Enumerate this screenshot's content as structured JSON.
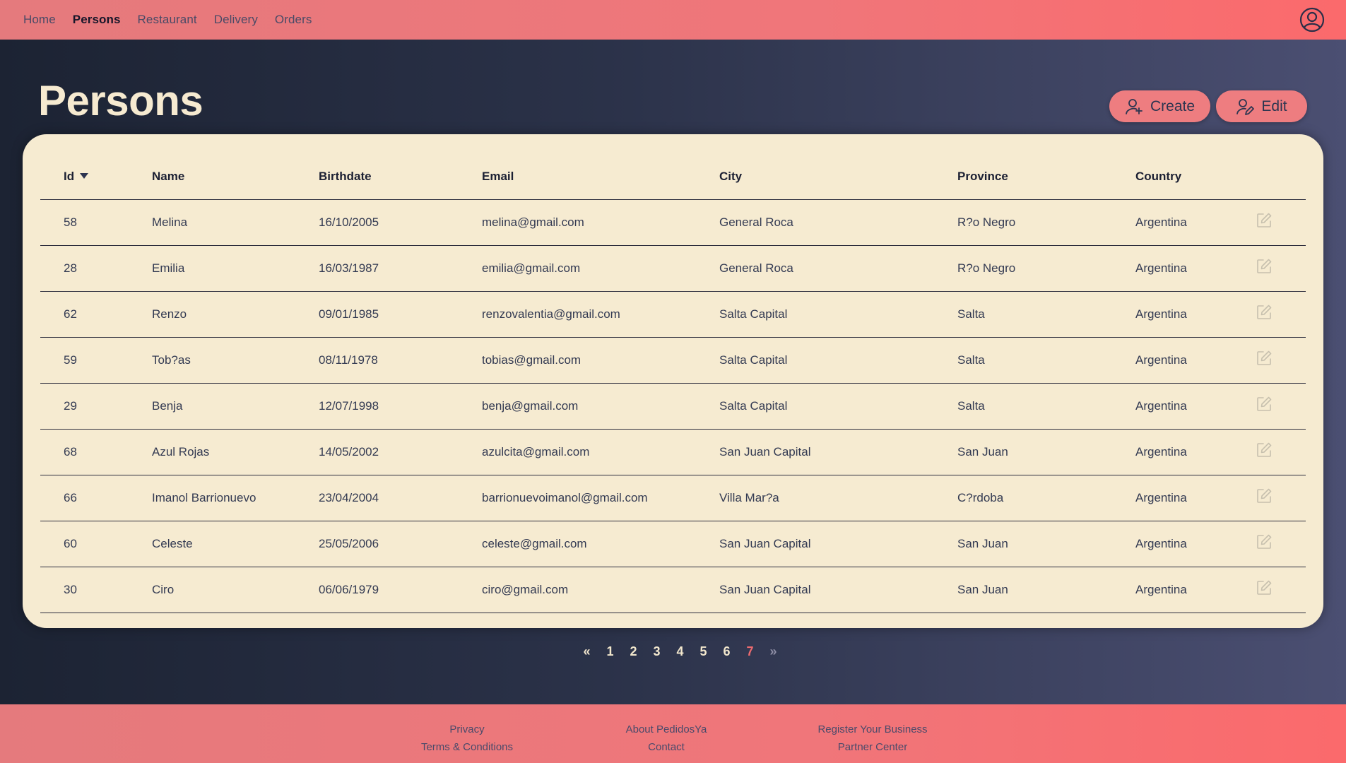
{
  "nav": {
    "items": [
      {
        "label": "Home",
        "active": false
      },
      {
        "label": "Persons",
        "active": true
      },
      {
        "label": "Restaurant",
        "active": false
      },
      {
        "label": "Delivery",
        "active": false
      },
      {
        "label": "Orders",
        "active": false
      }
    ],
    "user_icon": "user-circle-icon"
  },
  "page": {
    "title": "Persons",
    "create_label": "Create",
    "edit_label": "Edit"
  },
  "table": {
    "headers": {
      "id": "Id",
      "name": "Name",
      "birthdate": "Birthdate",
      "email": "Email",
      "city": "City",
      "province": "Province",
      "country": "Country"
    },
    "sort": {
      "column": "id",
      "direction": "desc"
    },
    "rows": [
      {
        "id": "58",
        "name": "Melina",
        "birthdate": "16/10/2005",
        "email": "melina@gmail.com",
        "city": "General Roca",
        "province": "R?o Negro",
        "country": "Argentina"
      },
      {
        "id": "28",
        "name": "Emilia",
        "birthdate": "16/03/1987",
        "email": "emilia@gmail.com",
        "city": "General Roca",
        "province": "R?o Negro",
        "country": "Argentina"
      },
      {
        "id": "62",
        "name": "Renzo",
        "birthdate": "09/01/1985",
        "email": "renzovalentia@gmail.com",
        "city": "Salta Capital",
        "province": "Salta",
        "country": "Argentina"
      },
      {
        "id": "59",
        "name": "Tob?as",
        "birthdate": "08/11/1978",
        "email": "tobias@gmail.com",
        "city": "Salta Capital",
        "province": "Salta",
        "country": "Argentina"
      },
      {
        "id": "29",
        "name": "Benja",
        "birthdate": "12/07/1998",
        "email": "benja@gmail.com",
        "city": "Salta Capital",
        "province": "Salta",
        "country": "Argentina"
      },
      {
        "id": "68",
        "name": "Azul Rojas",
        "birthdate": "14/05/2002",
        "email": "azulcita@gmail.com",
        "city": "San Juan Capital",
        "province": "San Juan",
        "country": "Argentina"
      },
      {
        "id": "66",
        "name": "Imanol Barrionuevo",
        "birthdate": "23/04/2004",
        "email": "barrionuevoimanol@gmail.com",
        "city": "Villa Mar?a",
        "province": "C?rdoba",
        "country": "Argentina"
      },
      {
        "id": "60",
        "name": "Celeste",
        "birthdate": "25/05/2006",
        "email": "celeste@gmail.com",
        "city": "San Juan Capital",
        "province": "San Juan",
        "country": "Argentina"
      },
      {
        "id": "30",
        "name": "Ciro",
        "birthdate": "06/06/1979",
        "email": "ciro@gmail.com",
        "city": "San Juan Capital",
        "province": "San Juan",
        "country": "Argentina"
      }
    ]
  },
  "pagination": {
    "prev": "«",
    "pages": [
      "1",
      "2",
      "3",
      "4",
      "5",
      "6",
      "7"
    ],
    "current": "7",
    "next": "»"
  },
  "footer": {
    "privacy": "Privacy",
    "terms": "Terms & Conditions",
    "about": "About PedidosYa",
    "contact": "Contact",
    "register": "Register Your Business",
    "partner": "Partner Center"
  },
  "colors": {
    "accent": "#ee7d80",
    "card": "#f6ebd1",
    "title": "#f6ead0",
    "active_page": "#ee6b6f"
  }
}
